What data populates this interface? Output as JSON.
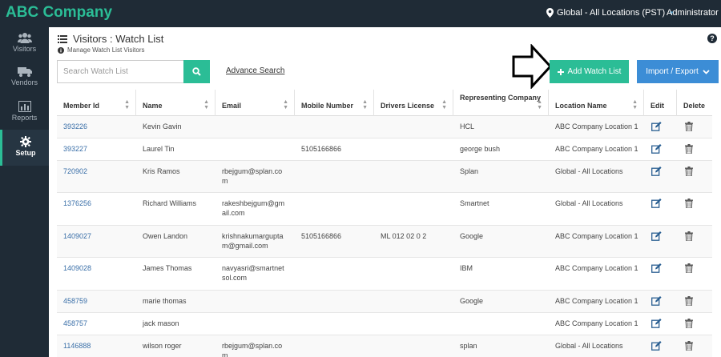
{
  "app": {
    "brand": "ABC Company"
  },
  "topbar": {
    "location": "Global - All Locations (PST)",
    "user": "Administrator"
  },
  "sidebar": {
    "items": [
      {
        "label": "Visitors",
        "icon": "users-icon"
      },
      {
        "label": "Vendors",
        "icon": "truck-icon"
      },
      {
        "label": "Reports",
        "icon": "bar-chart-icon"
      },
      {
        "label": "Setup",
        "icon": "gear-icon",
        "active": true
      }
    ]
  },
  "page": {
    "title": "Visitors : Watch List",
    "subtitle": "Manage Watch List Visitors"
  },
  "search": {
    "placeholder": "Search Watch List",
    "advanced_label": "Advance Search"
  },
  "actions": {
    "add_label": "Add Watch List",
    "import_label": "Import / Export"
  },
  "table": {
    "columns": [
      "Member Id",
      "Name",
      "Email",
      "Mobile Number",
      "Drivers License",
      "Representing Company",
      "Location Name",
      "Edit",
      "Delete"
    ],
    "rows": [
      {
        "id": "393226",
        "name": "Kevin Gavin",
        "email1": "",
        "email2": "",
        "mobile": "",
        "license": "",
        "company": "HCL",
        "location": "ABC Company Location 1"
      },
      {
        "id": "393227",
        "name": "Laurel Tin",
        "email1": "",
        "email2": "",
        "mobile": "5105166866",
        "license": "",
        "company": "george bush",
        "location": "ABC Company Location 1"
      },
      {
        "id": "720902",
        "name": "Kris Ramos",
        "email1": "rbejgum@splan.co",
        "email2": "m",
        "mobile": "",
        "license": "",
        "company": "Splan",
        "location": "Global - All Locations"
      },
      {
        "id": "1376256",
        "name": "Richard Williams",
        "email1": "rakeshbejgum@gm",
        "email2": "ail.com",
        "mobile": "",
        "license": "",
        "company": "Smartnet",
        "location": "Global - All Locations"
      },
      {
        "id": "1409027",
        "name": "Owen Landon",
        "email1": "krishnakumargupta",
        "email2": "m@gmail.com",
        "mobile": "5105166866",
        "license": "ML 012 02 0 2",
        "company": "Google",
        "location": "ABC Company Location 1"
      },
      {
        "id": "1409028",
        "name": "James Thomas",
        "email1": "navyasri@smartnet",
        "email2": "sol.com",
        "mobile": "",
        "license": "",
        "company": "IBM",
        "location": "ABC Company Location 1"
      },
      {
        "id": "458759",
        "name": "marie thomas",
        "email1": "",
        "email2": "",
        "mobile": "",
        "license": "",
        "company": "Google",
        "location": "ABC Company Location 1"
      },
      {
        "id": "458757",
        "name": "jack mason",
        "email1": "",
        "email2": "",
        "mobile": "",
        "license": "",
        "company": "",
        "location": "ABC Company Location 1"
      },
      {
        "id": "1146888",
        "name": "wilson roger",
        "email1": "rbejgum@splan.co",
        "email2": "m",
        "mobile": "",
        "license": "",
        "company": "splan",
        "location": "Global - All Locations"
      }
    ]
  },
  "colors": {
    "brand": "#2bbd96",
    "topbar": "#1f2b36",
    "primary_button": "#2bbd96",
    "secondary_button": "#3c8dd6",
    "link": "#3a6fa8"
  }
}
